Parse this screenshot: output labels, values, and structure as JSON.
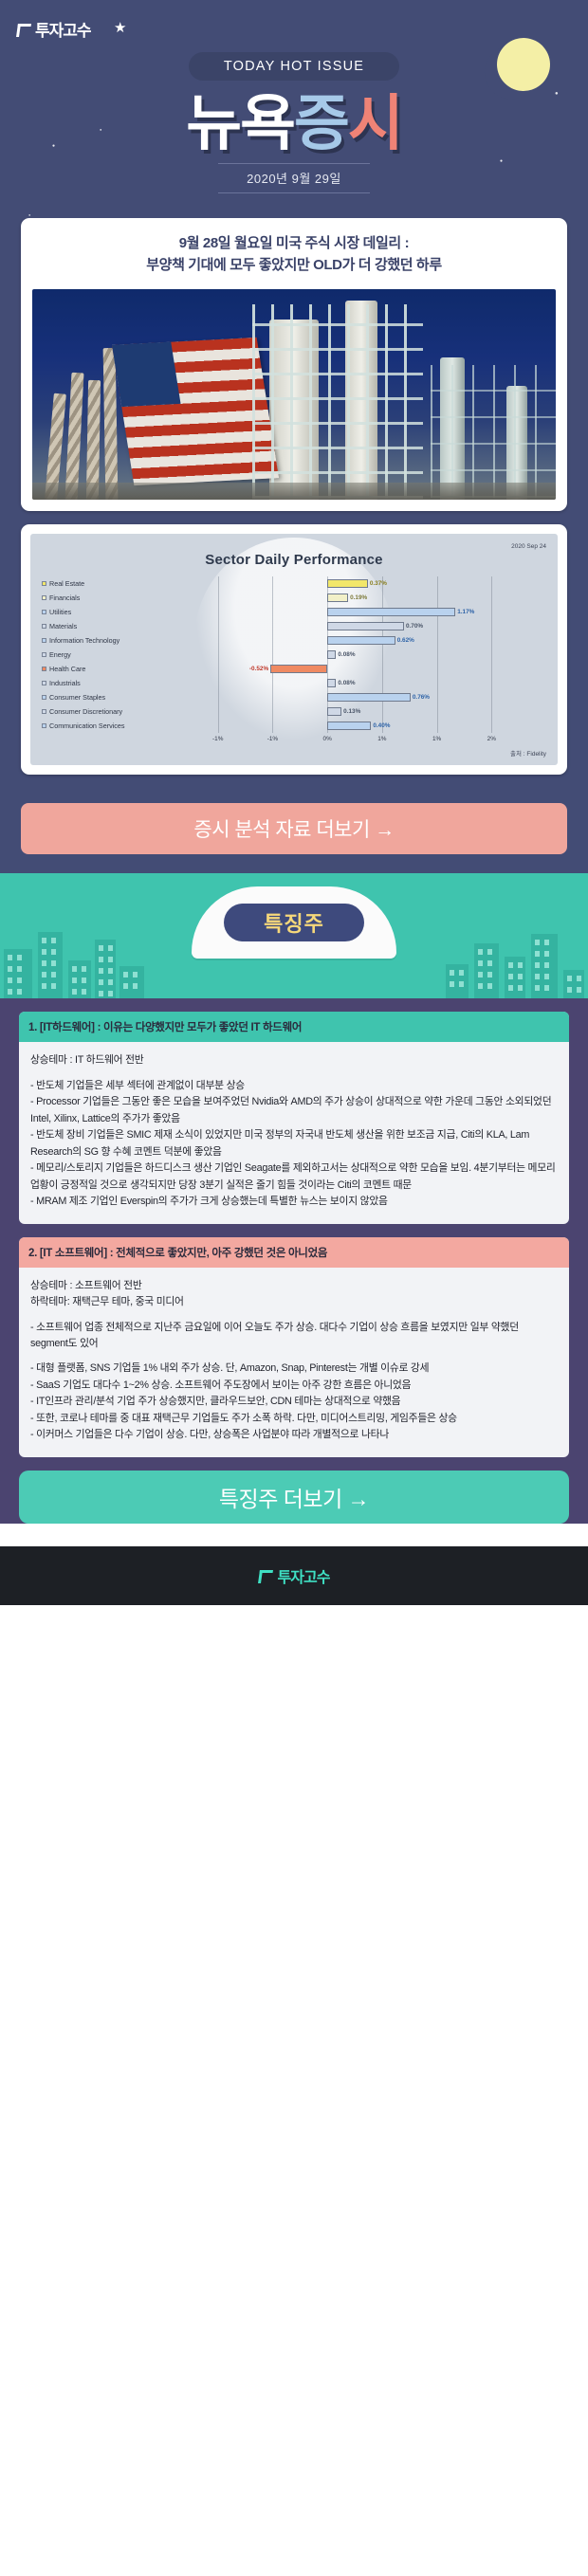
{
  "brand": {
    "name": "투자고수"
  },
  "hero": {
    "badge": "TODAY HOT ISSUE",
    "title_part1": "뉴욕",
    "title_part2": "증",
    "title_part3": "시",
    "date": "2020년 9월 29일",
    "colors": {
      "background": "#434c75",
      "badge_bg": "#3b4468",
      "moon": "#f4efa6",
      "title_blue": "#a6c9e8",
      "title_coral": "#ef8376"
    }
  },
  "headline": {
    "line1": "9월 28일 월요일 미국 주식 시장 데일리 :",
    "line2": "부양책 기대에 모두 좋았지만 OLD가 더 강했던 하루"
  },
  "chart_data": {
    "type": "bar",
    "title": "Sector Daily Performance",
    "date_label": "2020 Sep 24",
    "source": "출처 : Fidelity",
    "orientation": "horizontal",
    "xlabel": "",
    "ylabel": "",
    "xlim": [
      -1.5,
      2.0
    ],
    "tick_labels": [
      "-1%",
      "-1%",
      "0%",
      "1%",
      "1%",
      "2%"
    ],
    "tick_values": [
      -1.0,
      -0.5,
      0.0,
      0.5,
      1.0,
      1.5
    ],
    "grid": true,
    "categories": [
      "Real Estate",
      "Financials",
      "Utilities",
      "Materials",
      "Information Technology",
      "Energy",
      "Health Care",
      "Industrials",
      "Consumer Staples",
      "Consumer Discretionary",
      "Communication Services"
    ],
    "values": [
      0.37,
      0.19,
      1.17,
      0.7,
      0.62,
      0.08,
      -0.52,
      0.08,
      0.76,
      0.13,
      0.4
    ],
    "value_labels": [
      "0.37%",
      "0.19%",
      "1.17%",
      "0.70%",
      "0.62%",
      "0.08%",
      "-0.52%",
      "0.08%",
      "0.76%",
      "0.13%",
      "0.40%"
    ],
    "bar_colors": [
      "#f2e76a",
      "#f2f0c8",
      "#b9d2ee",
      "#cfd8e6",
      "#b9d2ee",
      "#cfd8e6",
      "#ef8a62",
      "#cfd8e6",
      "#b9d2ee",
      "#cfd8e6",
      "#b9d2ee"
    ],
    "label_colors": [
      "#8a7f1f",
      "#7d7a3a",
      "#2f64a8",
      "#4a5568",
      "#2f64a8",
      "#4a5568",
      "#c0392b",
      "#4a5568",
      "#2f64a8",
      "#4a5568",
      "#2f64a8"
    ]
  },
  "cta_primary": {
    "label": "증시 분석 자료 더보기  →"
  },
  "feature": {
    "ribbon_label": "특징주",
    "sections": [
      {
        "heading": "1. [IT하드웨어] : 이유는 다양했지만 모두가 좋았던 IT 하드웨어",
        "head_color": "#3fc4ae",
        "paragraphs": [
          "상승테마 : IT 하드웨어 전반",
          "- 반도체 기업들은 세부 섹터에 관계없이 대부분 상승\n- Processor 기업들은 그동안 좋은 모습을 보여주었던 Nvidia와 AMD의 주가 상승이 상대적으로 약한 가운데 그동안 소외되었던 Intel, Xilinx, Lattice의 주가가 좋았음\n- 반도체 장비 기업들은 SMIC 제재 소식이 있었지만 미국 정부의 자국내 반도체 생산을 위한 보조금 지급, Citi의 KLA, Lam Research의 SG 향 수혜 코멘트 덕분에 좋았음\n- 메모리/스토리지 기업들은 하드디스크 생산 기업인 Seagate를 제외하고서는 상대적으로 약한 모습을 보임. 4분기부터는 메모리 업황이 긍정적일 것으로 생각되지만 당장 3분기 실적은 줄기 힘들 것이라는 Citi의 코멘트 때문\n- MRAM 제조 기업인 Everspin의 주가가 크게 상승했는데 특별한 뉴스는 보이지 않았음"
        ]
      },
      {
        "heading": "2. [IT 소프트웨어] : 전체적으로 좋았지만, 아주 강했던 것은 아니었음",
        "head_color": "#f3a8a0",
        "paragraphs": [
          "상승테마 : 소프트웨어 전반\n하락테마: 재택근무 테마, 중국 미디어",
          "- 소프트웨어 업종 전체적으로 지난주 금요일에 이어 오늘도 주가 상승. 대다수 기업이 상승 흐름을 보였지만 일부 약했던 segment도 있어",
          "- 대형 플랫폼, SNS 기업들 1% 내외 주가 상승. 단, Amazon, Snap, Pinterest는 개별 이슈로 강세\n- SaaS 기업도 대다수 1~2% 상승. 소프트웨어 주도장에서 보이는 아주 강한 흐름은 아니었음\n- IT인프라 관리/분석 기업 주가 상승했지만, 클라우드보안, CDN 테마는 상대적으로 약했음\n- 또한, 코로나 테마를 중 대표 재택근무 기업들도 주가 소폭 하락. 다만, 미디어스트리밍, 게임주들은 상승\n- 이커머스 기업들은 다수 기업이 상승. 다만, 상승폭은 사업분야 따라 개별적으로 나타나"
        ]
      }
    ]
  },
  "cta_secondary": {
    "label": "특징주 더보기  →"
  },
  "footer": {
    "brand": "투자고수"
  }
}
